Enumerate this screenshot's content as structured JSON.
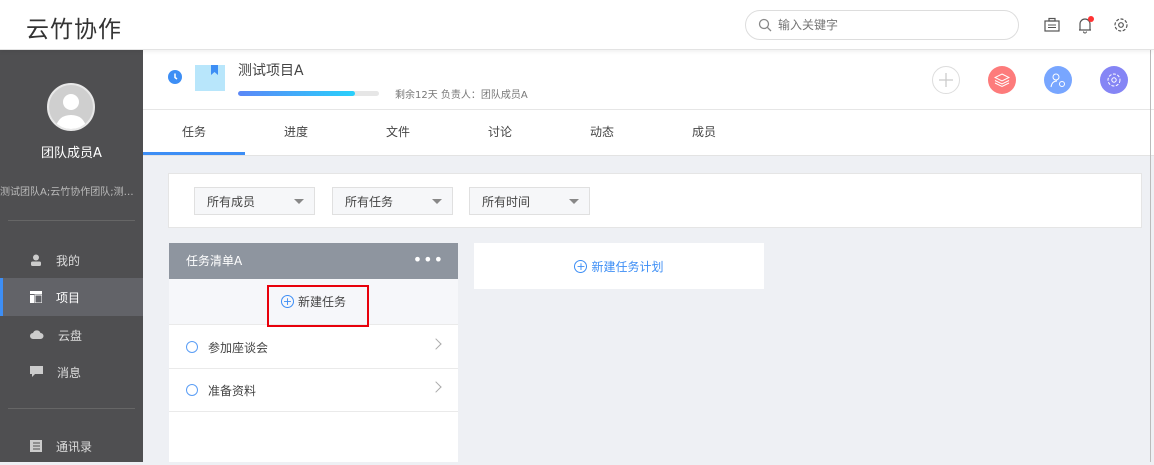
{
  "app": {
    "logo": "云竹协作"
  },
  "search": {
    "placeholder": "输入关键字"
  },
  "sidebar": {
    "user_name": "团队成员A",
    "teams": "测试团队A;云竹协作团队;测试...",
    "items": [
      {
        "label": "我的"
      },
      {
        "label": "项目"
      },
      {
        "label": "云盘"
      },
      {
        "label": "消息"
      },
      {
        "label": "通讯录"
      }
    ]
  },
  "project": {
    "title": "测试项目A",
    "progress_percent": 83,
    "meta": "剩余12天 负责人：团队成员A"
  },
  "tabs": [
    {
      "label": "任务"
    },
    {
      "label": "进度"
    },
    {
      "label": "文件"
    },
    {
      "label": "讨论"
    },
    {
      "label": "动态"
    },
    {
      "label": "成员"
    }
  ],
  "filters": [
    {
      "value": "所有成员"
    },
    {
      "value": "所有任务"
    },
    {
      "value": "所有时间"
    }
  ],
  "tasklist": {
    "title": "任务清单A",
    "more": "•••",
    "new_task": "新建任务",
    "tasks": [
      {
        "label": "参加座谈会"
      },
      {
        "label": "准备资料"
      }
    ]
  },
  "new_plan": "新建任务计划",
  "colors": {
    "accent": "#3d8ef5",
    "highlight": "#e8000b",
    "sidebar": "#4f4f51"
  }
}
